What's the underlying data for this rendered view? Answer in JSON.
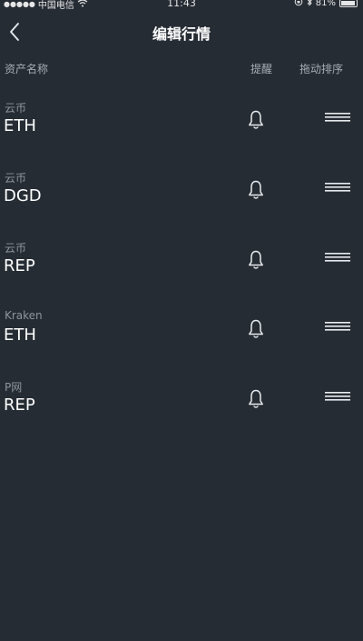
{
  "status_bar": {
    "carrier": "中国电信",
    "time": "11:43",
    "battery": "81%",
    "battery_level": 0.81
  },
  "nav": {
    "title": "编辑行情"
  },
  "columns": {
    "asset": "资产名称",
    "alert": "提醒",
    "sort": "拖动排序"
  },
  "rows": [
    {
      "exchange": "云币",
      "symbol": "ETH"
    },
    {
      "exchange": "云币",
      "symbol": "DGD"
    },
    {
      "exchange": "云币",
      "symbol": "REP"
    },
    {
      "exchange": "Kraken",
      "symbol": "ETH"
    },
    {
      "exchange": "P网",
      "symbol": "REP"
    }
  ],
  "icons": {
    "back": "chevron-left-icon",
    "alert": "bell-icon",
    "drag": "drag-handle-icon"
  }
}
